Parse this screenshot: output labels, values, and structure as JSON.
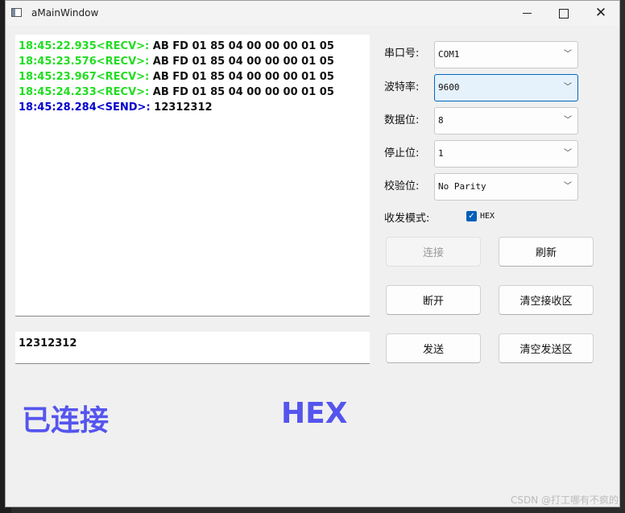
{
  "window": {
    "title": "aMainWindow"
  },
  "receive": {
    "lines": [
      {
        "timestamp": "18:45:22.935<RECV>:",
        "data": " AB FD 01 85 04 00 00 00 01 05"
      },
      {
        "timestamp": "18:45:23.576<RECV>:",
        "data": " AB FD 01 85 04 00 00 00 01 05"
      },
      {
        "timestamp": "18:45:23.967<RECV>:",
        "data": " AB FD 01 85 04 00 00 00 01 05"
      },
      {
        "timestamp": "18:45:24.233<RECV>:",
        "data": " AB FD 01 85 04 00 00 00 01 05"
      },
      {
        "timestamp": "18:45:28.284<SEND>:",
        "data": " 12312312"
      }
    ]
  },
  "send": {
    "text": "12312312"
  },
  "status": {
    "connection": "已连接",
    "mode": "HEX"
  },
  "settings": {
    "port_label": "串口号:",
    "port_value": "COM1",
    "baud_label": "波特率:",
    "baud_value": "9600",
    "databits_label": "数据位:",
    "databits_value": "8",
    "stopbits_label": "停止位:",
    "stopbits_value": "1",
    "parity_label": "校验位:",
    "parity_value": "No Parity",
    "mode_label": "收发模式:",
    "hex_checkbox_label": "HEX"
  },
  "buttons": {
    "connect": "连接",
    "refresh": "刷新",
    "disconnect": "断开",
    "clear_recv": "清空接收区",
    "send": "发送",
    "clear_send": "清空发送区"
  },
  "watermark": "CSDN @打工哪有不疯的",
  "colors": {
    "recv_timestamp": "#22dd22",
    "send_timestamp": "#0000cc",
    "status": "#5555ee"
  }
}
